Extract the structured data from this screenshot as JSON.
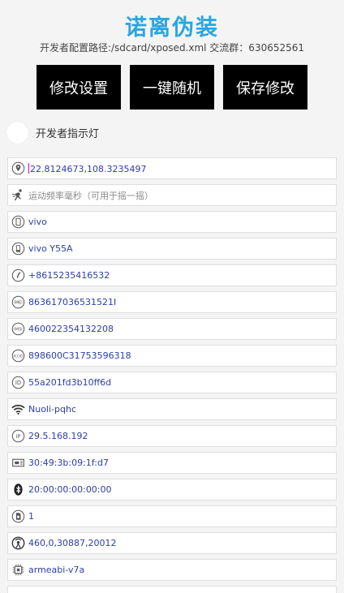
{
  "header": {
    "title": "诺离伪装",
    "subtitle": "开发者配置路径:/sdcard/xposed.xml  交流群：630652561"
  },
  "buttons": {
    "modify": "修改设置",
    "random": "一键随机",
    "save": "保存修改"
  },
  "developer_light": {
    "label": "开发者指示灯"
  },
  "fields": {
    "location": "22.8124673,108.3235497",
    "motion_placeholder": "运动频率毫秒（可用于摇一摇）",
    "brand": "vivo",
    "model": "vivo Y55A",
    "phone": "+8615235416532",
    "imei": "863617036531521I",
    "imsi": "460022354132208",
    "iccid": "898600C31753596318",
    "android_id": "55a201fd3b10ff6d",
    "wifi_name": "Nuoli-pqhc",
    "ip": "29.5.168.192",
    "mac": "30:49:3b:09:1f:d7",
    "bluetooth": "20:00:00:00:00:00",
    "sim_state": "1",
    "cell": "460,0,30887,20012",
    "cpu_abi": "armeabi-v7a"
  },
  "icons": {
    "location": "location-pin-icon",
    "motion": "running-icon",
    "brand": "phone-outline-icon",
    "model": "phone-device-icon",
    "phone": "handset-icon",
    "imei": "imei-icon",
    "imsi": "imsi-icon",
    "iccid": "iccid-icon",
    "android_id": "id-icon",
    "wifi_name": "wifi-icon",
    "ip": "ip-icon",
    "mac": "network-card-icon",
    "bluetooth": "bluetooth-icon",
    "sim_state": "sim-icon",
    "cell": "cell-tower-icon",
    "cpu_abi": "cpu-chip-icon"
  },
  "colors": {
    "title": "#29a6e0",
    "value_text": "#2c3ea8",
    "button_bg": "#000000"
  }
}
